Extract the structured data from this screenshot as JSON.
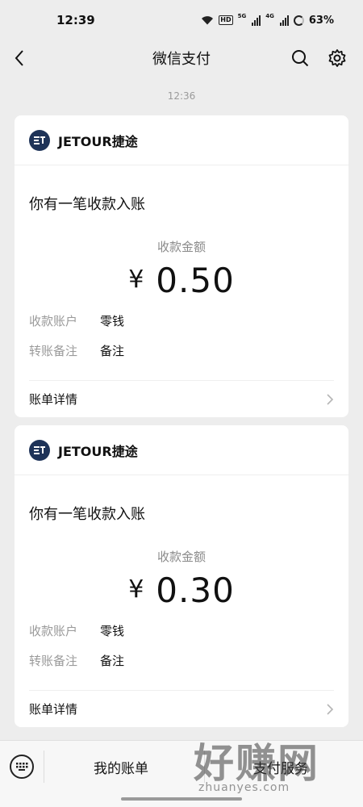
{
  "status_bar": {
    "time": "12:39",
    "battery": "63%",
    "hd": "HD",
    "net1": "5G",
    "net2": "4G"
  },
  "nav": {
    "title": "微信支付"
  },
  "chat": {
    "timestamp": "12:36"
  },
  "messages": [
    {
      "brand": "JETOUR捷途",
      "subject": "你有一笔收款入账",
      "amount_label": "收款金额",
      "currency": "¥",
      "amount": "0.50",
      "rows": [
        {
          "key": "收款账户",
          "value": "零钱"
        },
        {
          "key": "转账备注",
          "value": "备注"
        }
      ],
      "footer": "账单详情"
    },
    {
      "brand": "JETOUR捷途",
      "subject": "你有一笔收款入账",
      "amount_label": "收款金额",
      "currency": "¥",
      "amount": "0.30",
      "rows": [
        {
          "key": "收款账户",
          "value": "零钱"
        },
        {
          "key": "转账备注",
          "value": "备注"
        }
      ],
      "footer": "账单详情"
    }
  ],
  "bottom_menu": {
    "item1": "我的账单",
    "item2": "支付服务"
  },
  "watermark": {
    "big": "好赚网",
    "small": "zhuanyes.com"
  },
  "colors": {
    "brand_logo": "#1e3358",
    "background": "#ededed"
  }
}
